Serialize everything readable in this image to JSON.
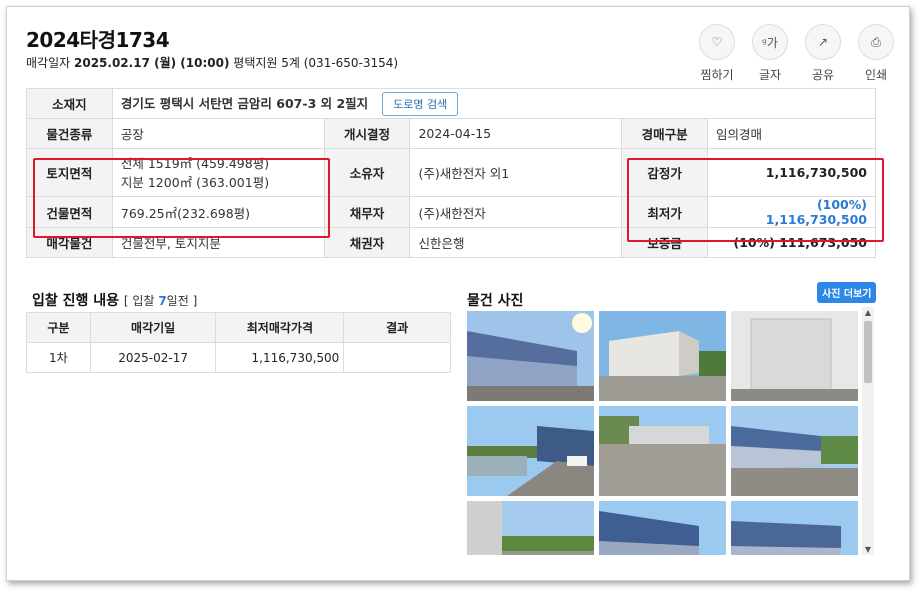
{
  "case": {
    "title": "2024타경1734",
    "sale_date_label": "매각일자",
    "sale_date": "2025.02.17 (월) (10:00)",
    "court": "평택지원 5계 (031-650-3154)"
  },
  "actions": [
    {
      "label": "찜하기",
      "icon": "heart-icon",
      "glyph": "♡"
    },
    {
      "label": "글자",
      "icon": "font-size-icon",
      "glyph": "ᵍ가"
    },
    {
      "label": "공유",
      "icon": "share-icon",
      "glyph": "↗"
    },
    {
      "label": "인쇄",
      "icon": "print-icon",
      "glyph": "⎙"
    }
  ],
  "info": {
    "address_label": "소재지",
    "address": "경기도 평택시 서탄면 금암리 607-3 외 2필지",
    "road_button": "도로명 검색",
    "type_label": "물건종류",
    "type": "공장",
    "start_label": "개시결정",
    "start": "2024-04-15",
    "auction_type_label": "경매구분",
    "auction_type": "임의경매",
    "land_label": "토지면적",
    "land_total": "전체 1519㎡ (459.498평)",
    "land_share": "지분 1200㎡ (363.001평)",
    "owner_label": "소유자",
    "owner": "(주)새한전자 외1",
    "appraisal_label": "감정가",
    "appraisal": "1,116,730,500",
    "building_label": "건물면적",
    "building": "769.25㎡(232.698평)",
    "debtor_label": "채무자",
    "debtor": "(주)새한전자",
    "min_price_label": "최저가",
    "min_price": "(100%) 1,116,730,500",
    "sale_items_label": "매각물건",
    "sale_items": "건물전부, 토지지분",
    "creditor_label": "채권자",
    "creditor": "신한은행",
    "deposit_label": "보증금",
    "deposit": "(10%) 111,673,050"
  },
  "bid": {
    "title": "입찰 진행 내용",
    "note_prefix": "[ 입찰 ",
    "note_days": "7",
    "note_suffix": "일전 ]",
    "headers": [
      "구분",
      "매각기일",
      "최저매각가격",
      "결과"
    ],
    "rows": [
      [
        "1차",
        "2025-02-17",
        "1,116,730,500",
        ""
      ]
    ]
  },
  "photos": {
    "title": "물건 사진",
    "more_button": "사진 더보기"
  },
  "colors": {
    "accent": "#2a7ad6",
    "highlight_box": "#e0162b"
  }
}
